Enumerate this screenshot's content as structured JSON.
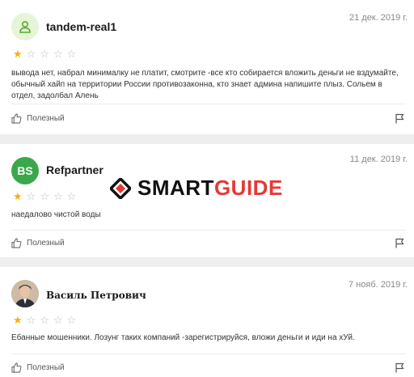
{
  "reviews": [
    {
      "username": "tandem-real1",
      "date": "21 дек. 2019 г.",
      "rating": 1,
      "text": "вывода нет, набрал минималку не платит, смотрите -все кто собирается вложить деньги не вздумайте, обычный хайп на территории России противозаконна, кто знает админа напишите плыз. Сольем в отдел, задолбал Алень",
      "useful_label": "Полезный"
    },
    {
      "username": "Refpartner",
      "date": "11 дек. 2019 г.",
      "rating": 1,
      "text": "наедалово чистой воды",
      "useful_label": "Полезный",
      "avatar_letters": "BS"
    },
    {
      "username": "Василь Петрович",
      "date": "7 нояб. 2019 г.",
      "rating": 1,
      "text": "Ебанные мошенники. Лозунг таких компаний -зарегистрируйся, вложи деньги и иди на хУй.",
      "useful_label": "Полезный"
    }
  ],
  "watermark": {
    "part1": "SMART",
    "part2": "GUIDE"
  },
  "colors": {
    "star_filled": "#f4b400",
    "star_empty": "#bdbdbd",
    "logo_red": "#e53935"
  },
  "icons": {
    "user": "user-icon",
    "thumb": "thumb-up-icon",
    "flag": "flag-icon"
  }
}
